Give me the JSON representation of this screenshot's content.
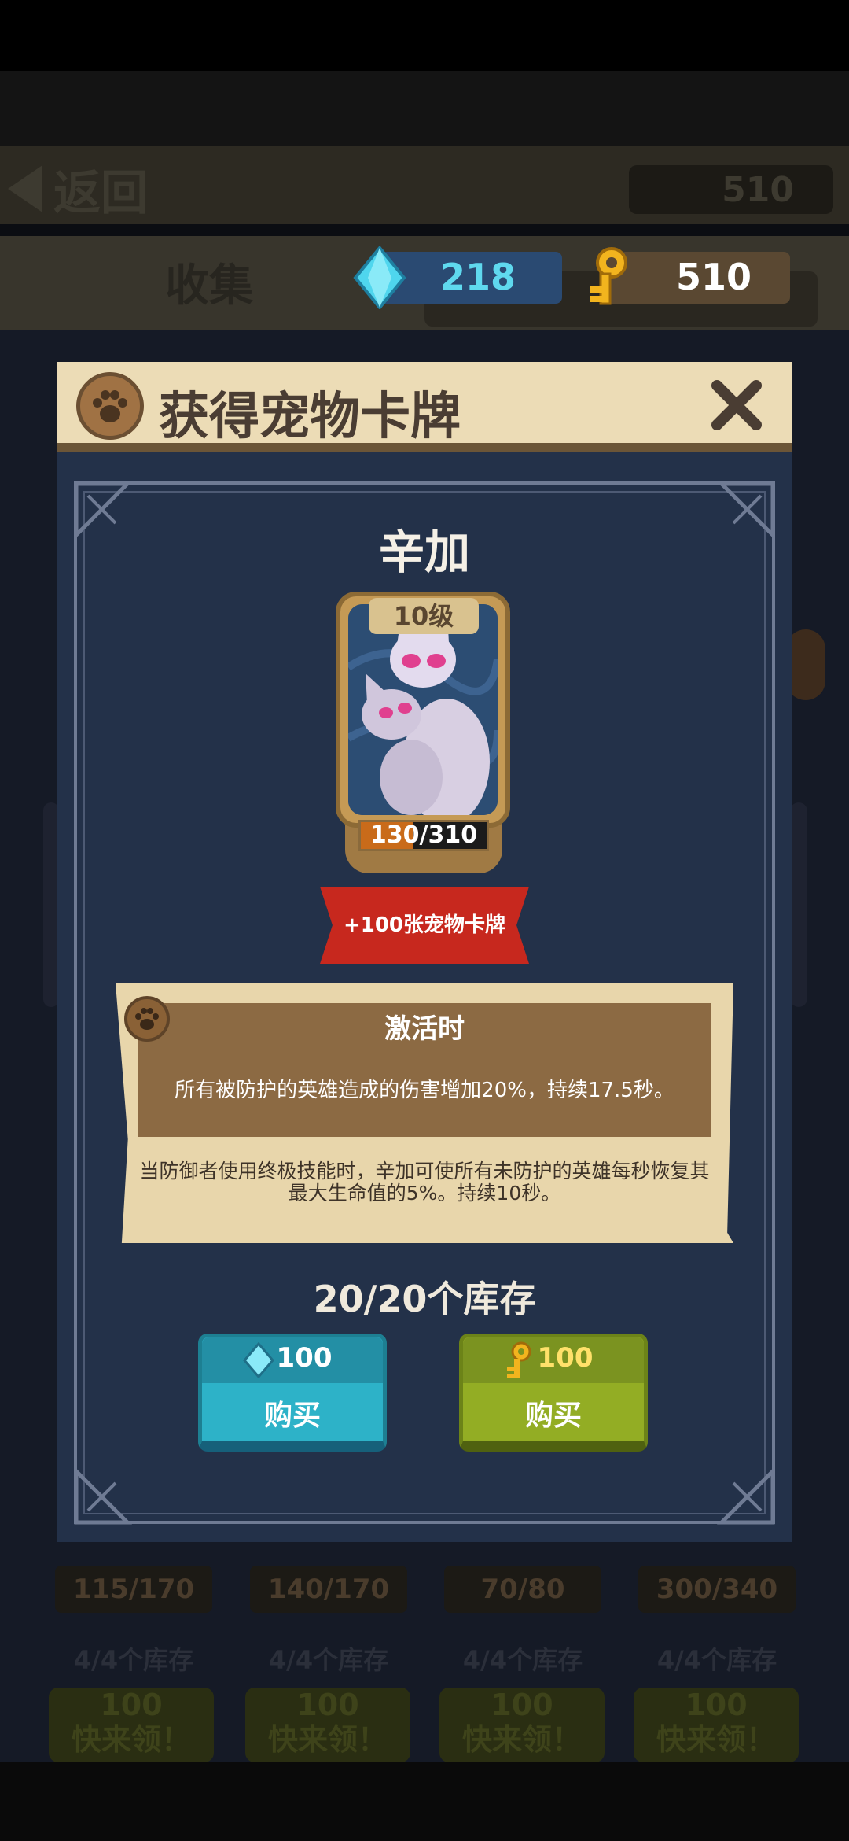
{
  "background": {
    "back_label": "返回",
    "top_keys": "510",
    "tab_label": "收集",
    "cards": [
      {
        "progress": "115/170",
        "stock": "4/4个库存",
        "price": "100",
        "claim": "快来领！"
      },
      {
        "progress": "140/170",
        "stock": "4/4个库存",
        "price": "100",
        "claim": "快来领！"
      },
      {
        "progress": "70/80",
        "stock": "4/4个库存",
        "price": "100",
        "claim": "快来领！"
      },
      {
        "progress": "300/340",
        "stock": "4/4个库存",
        "price": "100",
        "claim": "快来领！"
      }
    ]
  },
  "currency": {
    "gems": "218",
    "keys": "510"
  },
  "modal": {
    "title": "获得宠物卡牌",
    "pet_name": "辛加",
    "level": "10级",
    "progress_text": "130/310",
    "progress_fraction": 0.419,
    "reward_ribbon": "+100张宠物卡牌",
    "active_title": "激活时",
    "active_desc": "所有被防护的英雄造成的伤害增加20%，持续17.5秒。",
    "passive_desc": "当防御者使用终极技能时，辛加可使所有未防护的英雄每秒恢复其最大生命值的5%。持续10秒。",
    "stock": "20/20个库存",
    "buy_gem": {
      "price": "100",
      "label": "购买"
    },
    "buy_key": {
      "price": "100",
      "label": "购买"
    }
  },
  "colors": {
    "modal_bg": "#233149",
    "header_bg": "#ecdcb6",
    "gem_button": "#2db2c8",
    "key_button": "#93ad24",
    "ribbon": "#c7281e",
    "progress_fill": "#c96b1a"
  },
  "icons": {
    "gem": "gem-icon",
    "key": "key-icon",
    "paw": "paw-icon",
    "close": "close-icon",
    "back": "back-arrow-icon"
  }
}
